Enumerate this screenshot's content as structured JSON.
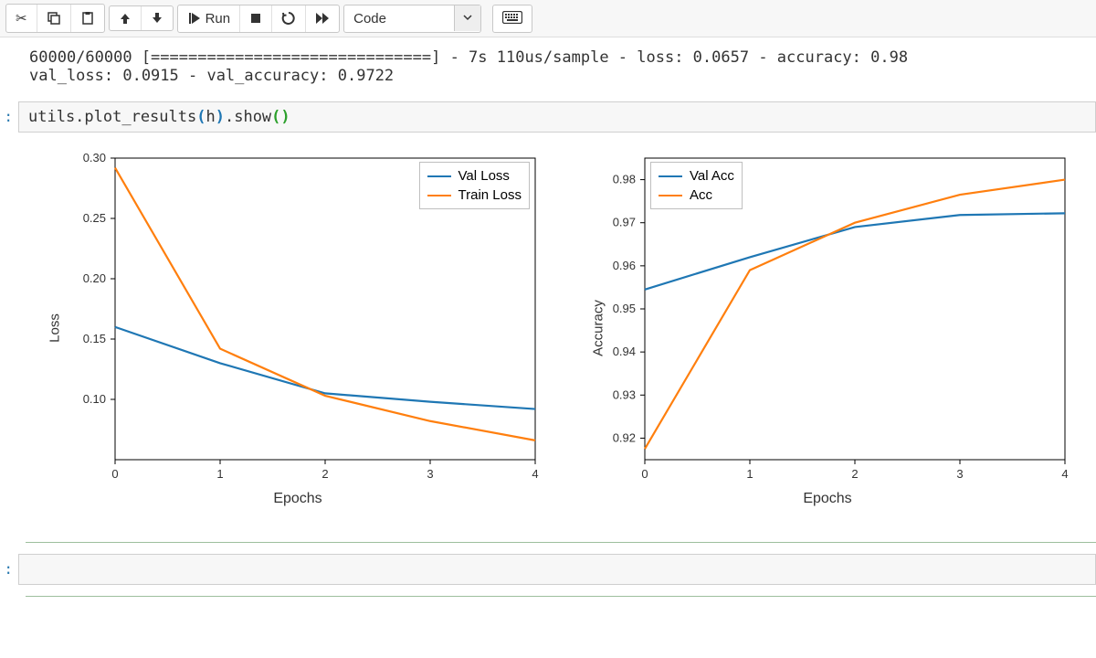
{
  "toolbar": {
    "run_label": "Run",
    "cell_type": "Code"
  },
  "output": {
    "line1": "60000/60000 [==============================] - 7s 110us/sample - loss: 0.0657 - accuracy: 0.98",
    "line2": "val_loss: 0.0915 - val_accuracy: 0.9722"
  },
  "code_cell": {
    "prompt": ":",
    "text": "utils.plot_results(h).show()"
  },
  "empty_cell_prompt": ":",
  "colors": {
    "series1": "#1f77b4",
    "series2": "#ff7f0e"
  },
  "chart_data": [
    {
      "type": "line",
      "xlabel": "Epochs",
      "ylabel": "Loss",
      "x": [
        0,
        1,
        2,
        3,
        4
      ],
      "xlim": [
        0,
        4
      ],
      "ylim": [
        0.05,
        0.3
      ],
      "yticks": [
        0.1,
        0.15,
        0.2,
        0.25,
        0.3
      ],
      "legend_pos": "top-right",
      "series": [
        {
          "name": "Val Loss",
          "color": "#1f77b4",
          "values": [
            0.16,
            0.13,
            0.105,
            0.098,
            0.092
          ]
        },
        {
          "name": "Train Loss",
          "color": "#ff7f0e",
          "values": [
            0.292,
            0.142,
            0.103,
            0.082,
            0.066
          ]
        }
      ]
    },
    {
      "type": "line",
      "xlabel": "Epochs",
      "ylabel": "Accuracy",
      "x": [
        0,
        1,
        2,
        3,
        4
      ],
      "xlim": [
        0,
        4
      ],
      "ylim": [
        0.915,
        0.985
      ],
      "yticks": [
        0.92,
        0.93,
        0.94,
        0.95,
        0.96,
        0.97,
        0.98
      ],
      "legend_pos": "top-left",
      "series": [
        {
          "name": "Val Acc",
          "color": "#1f77b4",
          "values": [
            0.9545,
            0.962,
            0.969,
            0.9718,
            0.9722
          ]
        },
        {
          "name": "Acc",
          "color": "#ff7f0e",
          "values": [
            0.9175,
            0.959,
            0.97,
            0.9765,
            0.98
          ]
        }
      ]
    }
  ]
}
